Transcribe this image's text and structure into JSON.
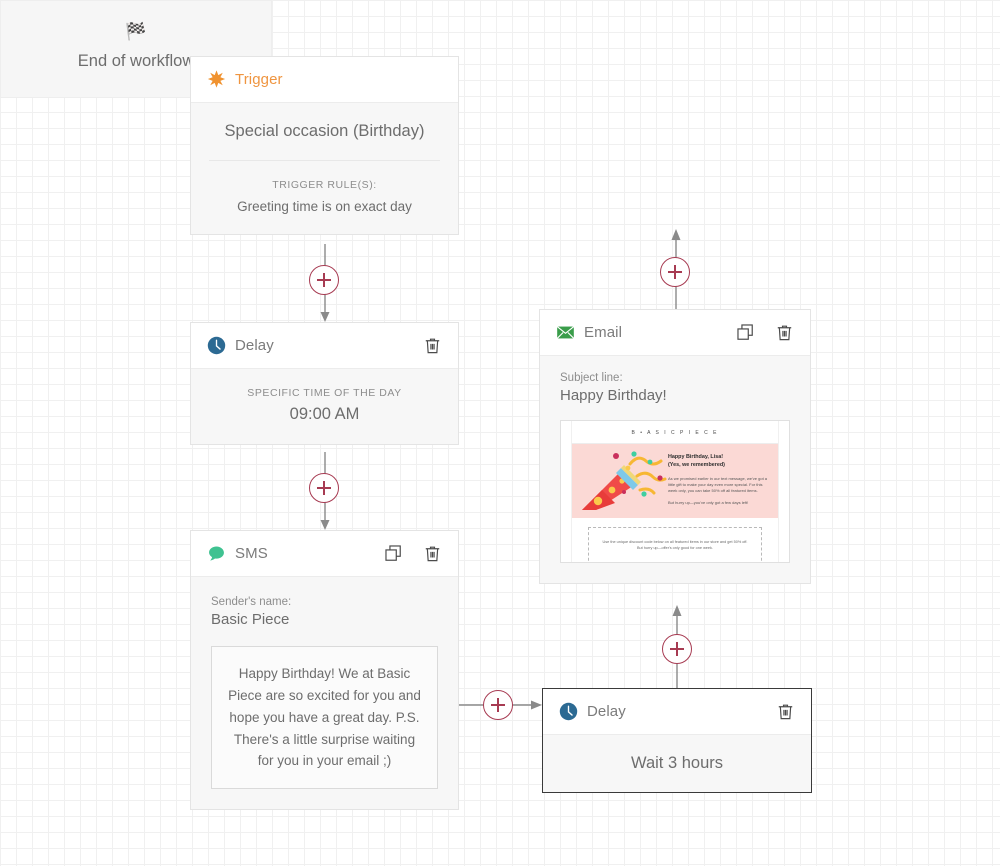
{
  "canvas": {
    "background_color": "#ffffff",
    "grid_color": "#f0f0f0",
    "connector_color": "#8a8a8a",
    "accent_color": "#a73b52"
  },
  "nodes": {
    "trigger": {
      "header_label": "Trigger",
      "icon": "burst-star-icon",
      "icon_color": "#ef9540",
      "title": "Special occasion (Birthday)",
      "rules_label": "TRIGGER RULE(S):",
      "rule_value": "Greeting time is on exact day"
    },
    "delay_1": {
      "header_label": "Delay",
      "icon": "clock-icon",
      "icon_color": "#2c6a93",
      "caption": "SPECIFIC TIME OF THE DAY",
      "value": "09:00 AM",
      "delete_icon": "trash-icon"
    },
    "sms": {
      "header_label": "SMS",
      "icon": "speech-bubble-icon",
      "icon_color": "#3fc291",
      "duplicate_icon": "copy-icon",
      "delete_icon": "trash-icon",
      "sender_label": "Sender's name:",
      "sender_value": "Basic Piece",
      "message": "Happy Birthday! We at Basic Piece are so excited for you and hope you have a great day. P.S. There's a little surprise waiting for you in your email ;)"
    },
    "delay_2": {
      "header_label": "Delay",
      "icon": "clock-icon",
      "icon_color": "#2c6a93",
      "delete_icon": "trash-icon",
      "value": "Wait 3 hours",
      "selected": true
    },
    "email": {
      "header_label": "Email",
      "icon": "envelope-icon",
      "icon_color": "#3a9d4a",
      "duplicate_icon": "copy-icon",
      "delete_icon": "trash-icon",
      "subject_label": "Subject line:",
      "subject_value": "Happy Birthday!",
      "preview": {
        "brand": "B • A S I C   P I E C E",
        "heading_line1": "Happy Birthday, Lisa!",
        "heading_line2": "(Yes, we remembered)",
        "paragraph": "As we promised earlier in our text message, we've got a little gift to make your day even more special. For this week only, you can take 50% off all featured items.",
        "paragraph2": "But hurry up—you've only got a few days left!",
        "coupon_text": "Use the unique discount code below on all featured items in our store and get 50% off. But hurry up—offer's only good for one week.",
        "hero_background": "#fbd9d5",
        "illustration": "party-popper-icon"
      }
    },
    "end": {
      "icon": "checkered-flag-icon",
      "label": "End of workflow"
    }
  },
  "connectors": {
    "add_button_label": "+",
    "add_buttons": [
      "add-step-after-trigger",
      "add-step-after-delay-1",
      "add-step-after-sms",
      "add-step-after-delay-2",
      "add-step-after-email"
    ]
  }
}
